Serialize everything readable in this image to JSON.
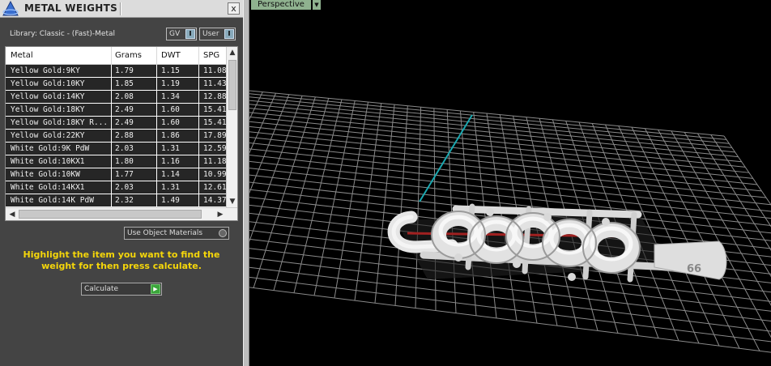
{
  "panel": {
    "title": "METAL WEIGHTS",
    "close_label": "x",
    "library_label": "Library: Classic - (Fast)-Metal",
    "dropdowns": [
      {
        "label": "GV"
      },
      {
        "label": "User"
      }
    ],
    "table": {
      "columns": [
        "Metal",
        "Grams",
        "DWT",
        "SPG"
      ],
      "rows": [
        [
          "Yellow Gold:9KY",
          "1.79",
          "1.15",
          "11.08"
        ],
        [
          "Yellow Gold:10KY",
          "1.85",
          "1.19",
          "11.43"
        ],
        [
          "Yellow Gold:14KY",
          "2.08",
          "1.34",
          "12.88"
        ],
        [
          "Yellow Gold:18KY",
          "2.49",
          "1.60",
          "15.41"
        ],
        [
          "Yellow Gold:18KY R...",
          "2.49",
          "1.60",
          "15.41"
        ],
        [
          "Yellow Gold:22KY",
          "2.88",
          "1.86",
          "17.89"
        ],
        [
          "White Gold:9K PdW",
          "2.03",
          "1.31",
          "12.59"
        ],
        [
          "White Gold:10KX1",
          "1.80",
          "1.16",
          "11.18"
        ],
        [
          "White Gold:10KW",
          "1.77",
          "1.14",
          "10.99"
        ],
        [
          "White Gold:14KX1",
          "2.03",
          "1.31",
          "12.61"
        ],
        [
          "White Gold:14K PdW",
          "2.32",
          "1.49",
          "14.37"
        ]
      ]
    },
    "use_object_materials": "Use Object Materials",
    "help_text": "Highlight the item you want to find the weight for then press calculate.",
    "calculate_label": "Calculate"
  },
  "viewport": {
    "view_name": "Perspective",
    "pendant_text": "66"
  },
  "colors": {
    "panel_bg": "#444444",
    "help_text": "#f5d60a",
    "grid_line": "#8a8a8a",
    "axis_line": "#1aa8b0",
    "view_label_bg": "#8fb28f"
  }
}
